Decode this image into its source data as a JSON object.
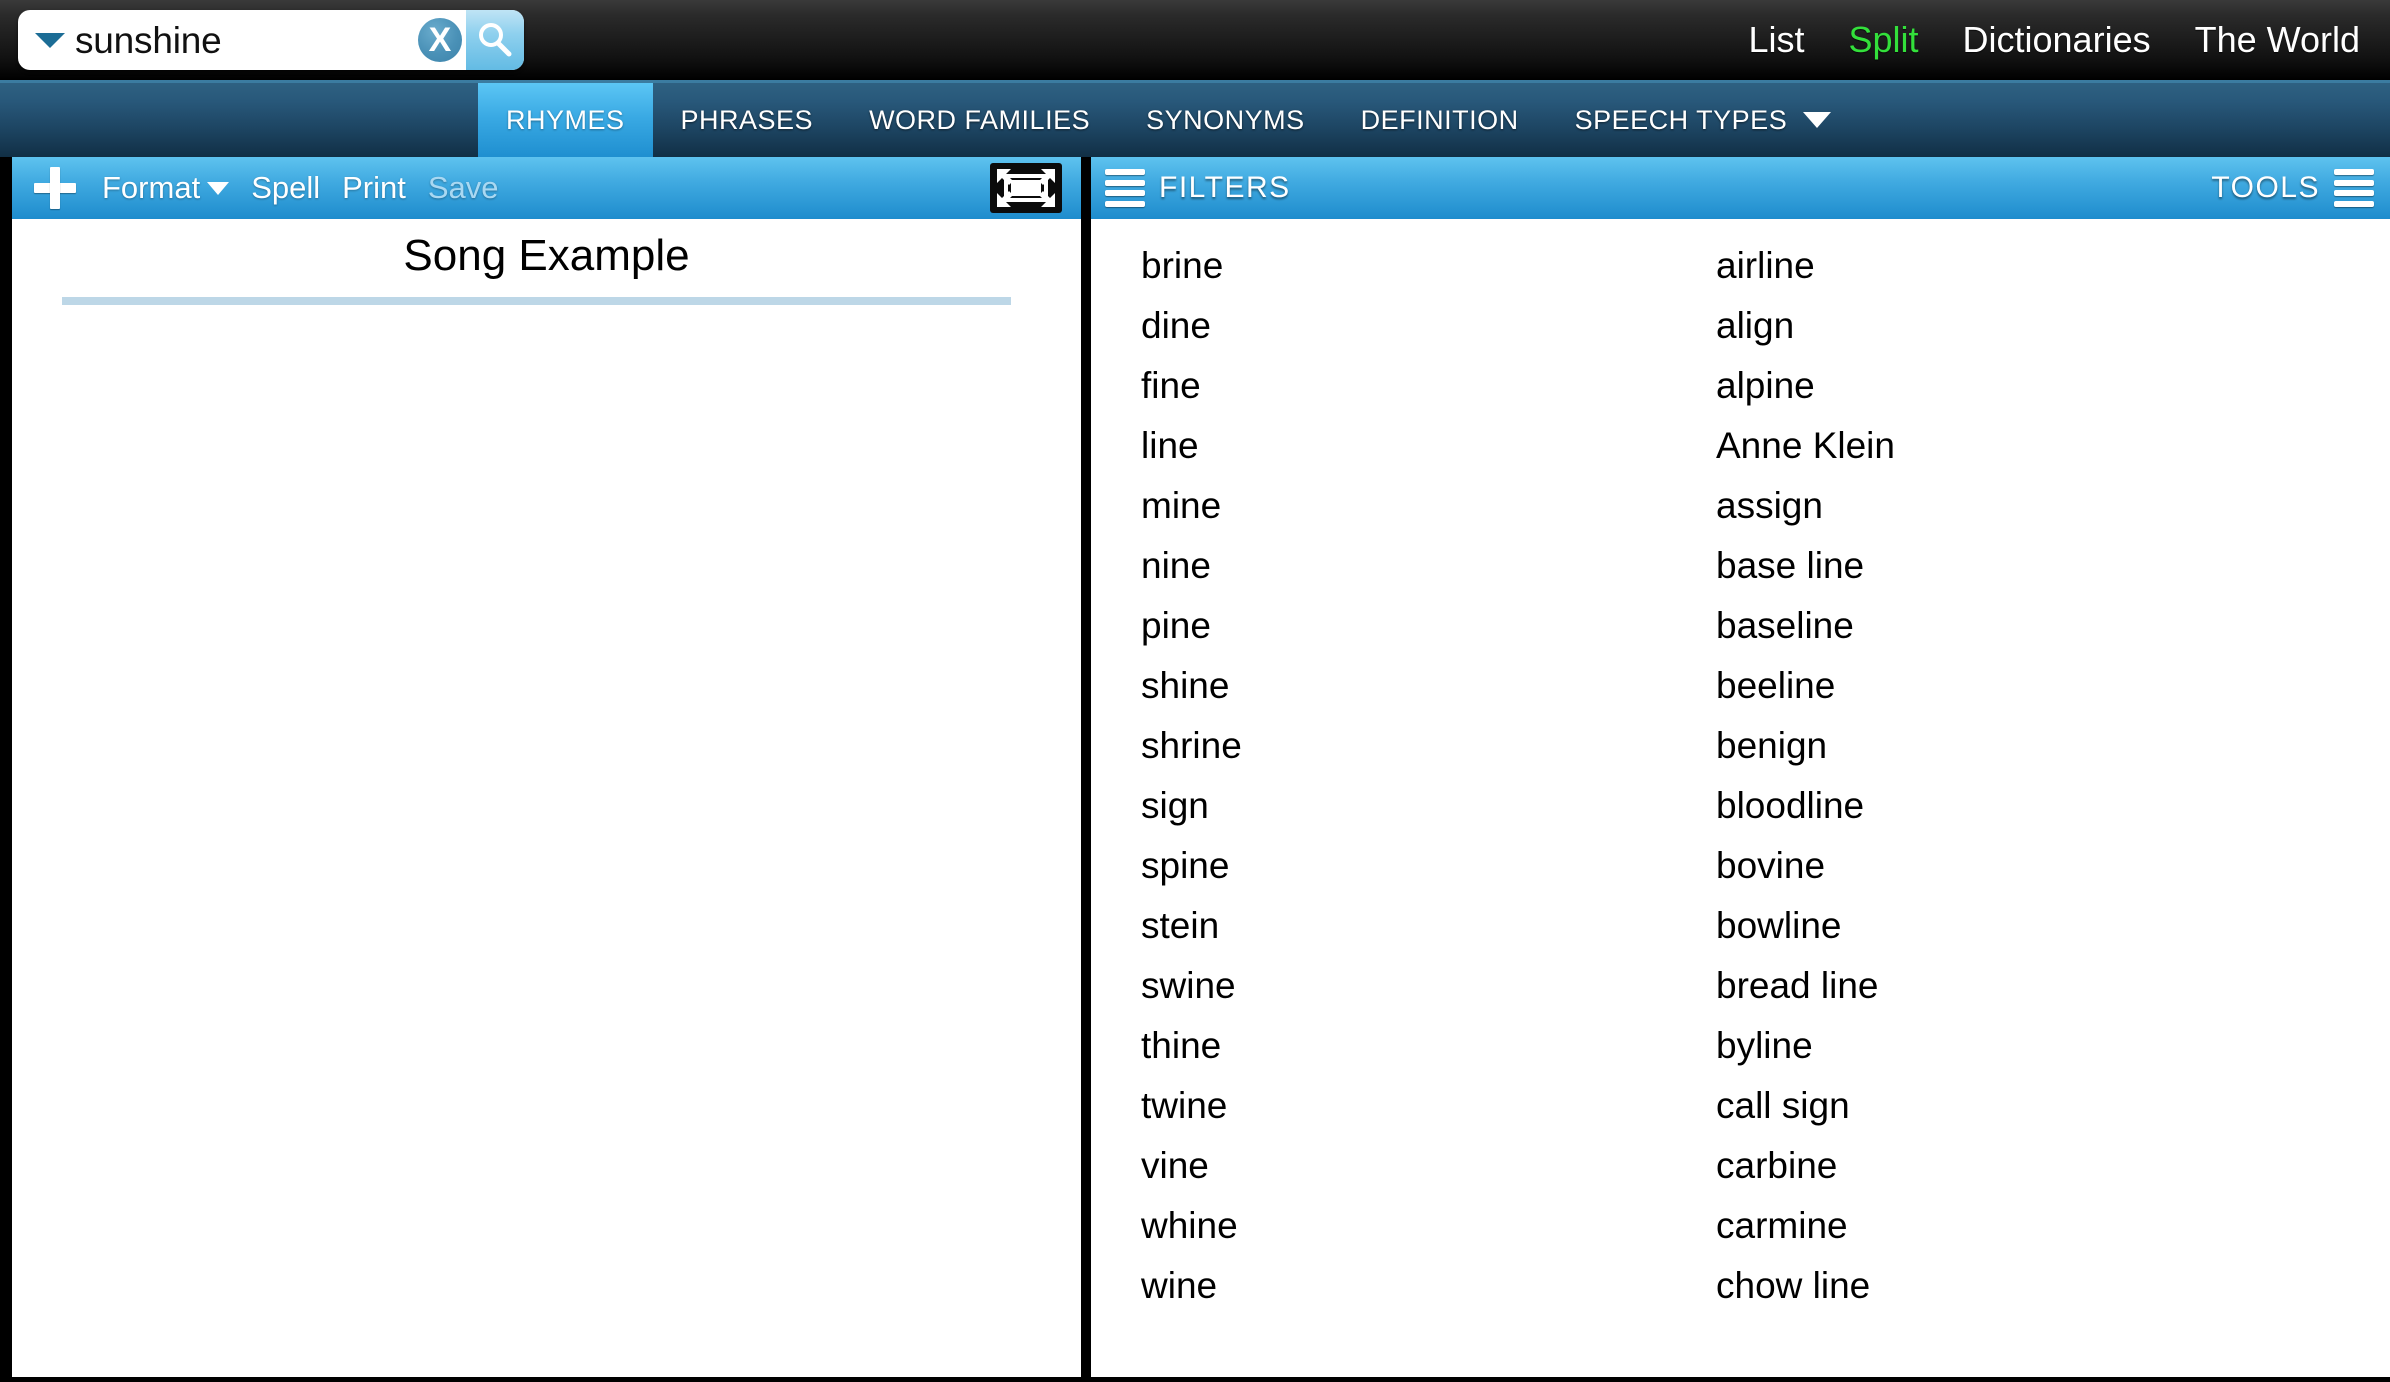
{
  "header": {
    "search": {
      "value": "sunshine",
      "placeholder": "",
      "dropdown_icon": "caret-down-icon",
      "clear_icon": "clear-x-icon",
      "clear_label": "X",
      "go_icon": "magnifier-icon"
    },
    "nav": [
      {
        "label": "List",
        "active": false
      },
      {
        "label": "Split",
        "active": true
      },
      {
        "label": "Dictionaries",
        "active": false
      },
      {
        "label": "The World",
        "active": false
      }
    ],
    "accent_active_color": "#33e03b",
    "background_color": "#000000"
  },
  "tabs": [
    {
      "label": "RHYMES",
      "active": true
    },
    {
      "label": "PHRASES",
      "active": false
    },
    {
      "label": "WORD FAMILIES",
      "active": false
    },
    {
      "label": "SYNONYMS",
      "active": false
    },
    {
      "label": "DEFINITION",
      "active": false
    },
    {
      "label": "SPEECH TYPES",
      "active": false,
      "has_chevron": true
    }
  ],
  "editor": {
    "toolbar": {
      "add_icon": "plus-icon",
      "format_label": "Format",
      "format_chevron_icon": "caret-down-icon",
      "spell_label": "Spell",
      "print_label": "Print",
      "save_label": "Save",
      "save_disabled": true,
      "fullscreen_icon": "fullscreen-expand-icon"
    },
    "document_title": "Song Example",
    "document_body": ""
  },
  "results": {
    "filters_label": "FILTERS",
    "filters_icon": "hamburger-menu-icon",
    "tools_label": "TOOLS",
    "tools_icon": "hamburger-menu-icon",
    "column_one": [
      "brine",
      "dine",
      "fine",
      "line",
      "mine",
      "nine",
      "pine",
      "shine",
      "shrine",
      "sign",
      "spine",
      "stein",
      "swine",
      "thine",
      "twine",
      "vine",
      "whine",
      "wine"
    ],
    "column_two": [
      "airline",
      "align",
      "alpine",
      "Anne Klein",
      "assign",
      "base line",
      "baseline",
      "beeline",
      "benign",
      "bloodline",
      "bovine",
      "bowline",
      "bread line",
      "byline",
      "call sign",
      "carbine",
      "carmine",
      "chow line"
    ]
  },
  "colors": {
    "toolbar_blue_top": "#5ec3ef",
    "toolbar_blue_bottom": "#1e8ccd",
    "tabbar_top": "#2e6182",
    "tabbar_bottom": "#112f45",
    "active_tab": "#3aaae4",
    "divider_blue": "#bdd7e7"
  }
}
